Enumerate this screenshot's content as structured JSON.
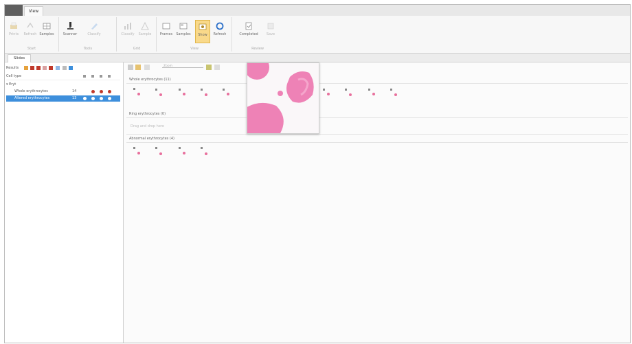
{
  "app": {
    "button_label": "",
    "menu_tab": "View"
  },
  "ribbon": {
    "groups": [
      {
        "label": "Start"
      },
      {
        "label": "Tools"
      },
      {
        "label": "Grid"
      },
      {
        "label": "View"
      },
      {
        "label": "Review"
      }
    ],
    "buttons": [
      {
        "label": "Prints",
        "icon": "print-icon"
      },
      {
        "label": "Refresh",
        "icon": "refresh-icon"
      },
      {
        "label": "Samples",
        "icon": "grid-icon"
      },
      {
        "label": "Scanner",
        "icon": "microscope-icon"
      },
      {
        "label": "Classify",
        "icon": "pen-icon"
      },
      {
        "label": "Classify",
        "icon": "chart-icon"
      },
      {
        "label": "Sample",
        "icon": "warning-icon"
      },
      {
        "label": "Frames",
        "icon": "frames-icon"
      },
      {
        "label": "Samples",
        "icon": "samples-icon"
      },
      {
        "label": "Show",
        "icon": "show-icon"
      },
      {
        "label": "Refresh",
        "icon": "cycle-icon"
      },
      {
        "label": "Completed",
        "icon": "check-doc-icon"
      },
      {
        "label": "Save",
        "icon": "save-icon"
      }
    ]
  },
  "document_tab": "Slides",
  "sidebar": {
    "results_label": "Results",
    "cell_type_header": "Cell type",
    "tree": [
      {
        "label": "Eryt",
        "level": 0
      },
      {
        "label": "Whole erythrocytes",
        "level": 1,
        "count": "14"
      },
      {
        "label": "Altered erythrocytes",
        "level": 1,
        "count": "13",
        "selected": true
      }
    ]
  },
  "main": {
    "zoom_label": "Zoom",
    "sections": [
      {
        "title": "Whole erythrocytes (11)"
      },
      {
        "title": "Ring erythrocytes (0)",
        "placeholder": "Drag and drop here"
      },
      {
        "title": "Abnormal erythrocytes (4)"
      }
    ]
  },
  "colors": {
    "accent_blue": "#3d8fdc",
    "active_button": "#f9d98a",
    "red_marker": "#c0392b",
    "cell_pink": "#e8709d",
    "preview_pink": "#ee82b6"
  }
}
